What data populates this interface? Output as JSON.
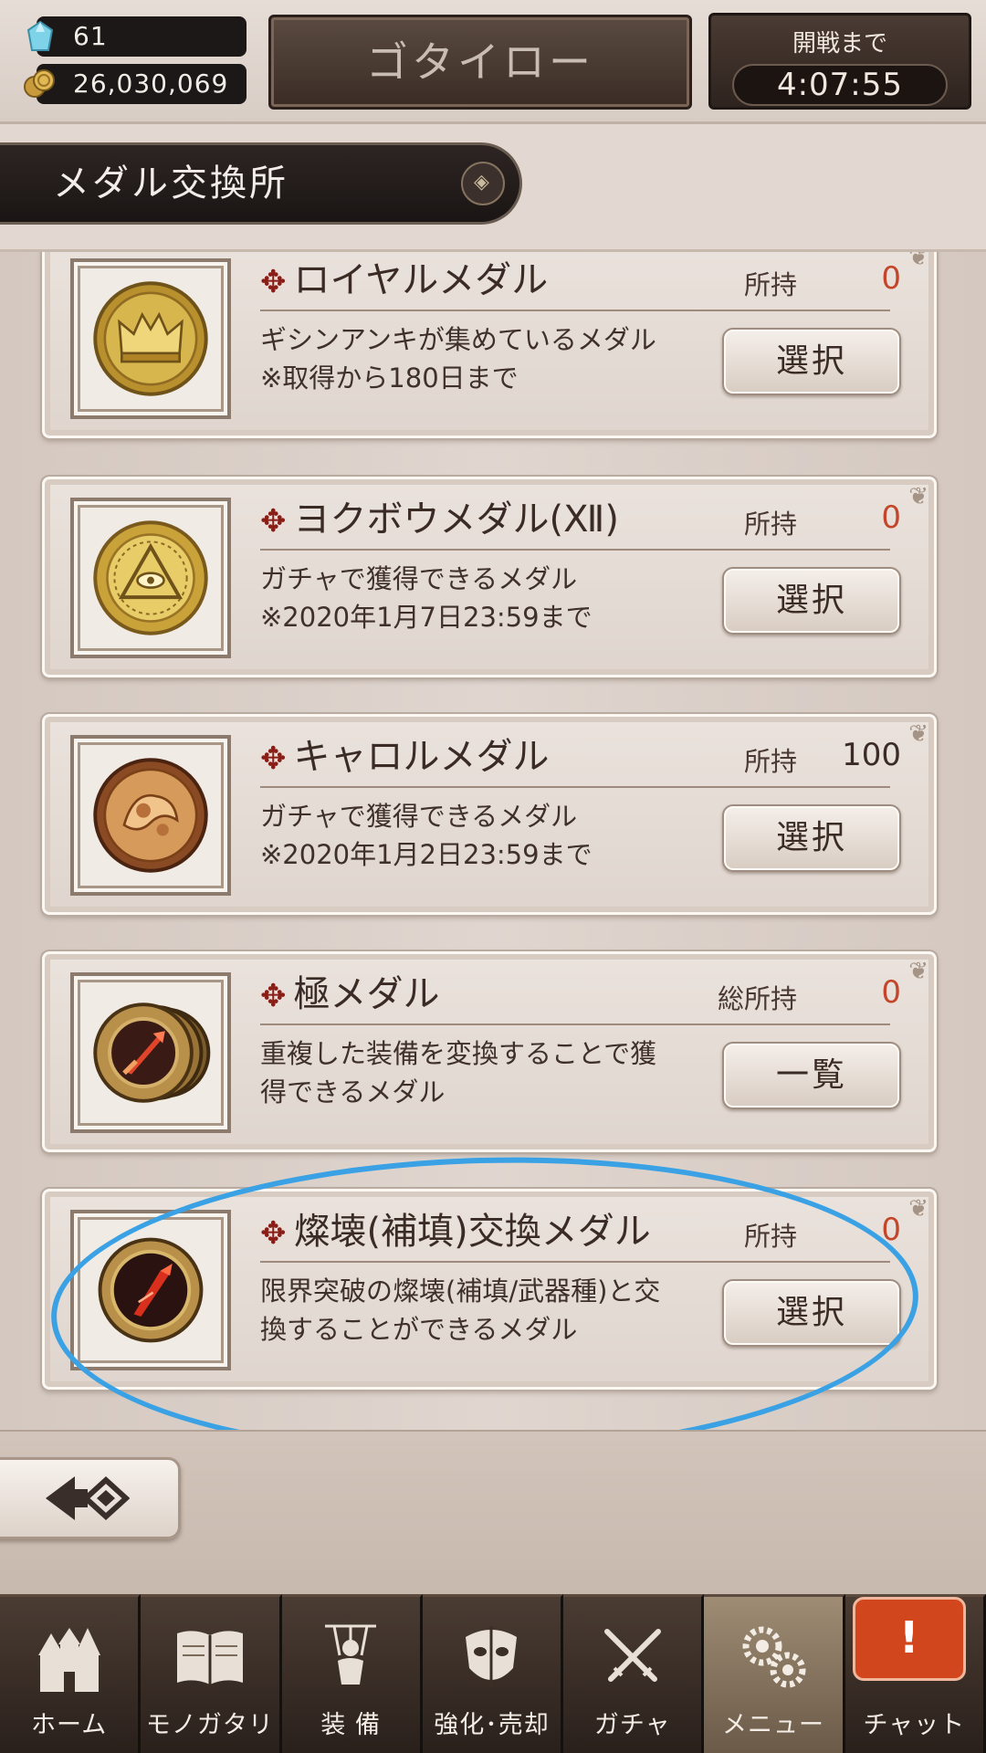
{
  "hud": {
    "gems": "61",
    "gold": "26,030,069",
    "player_name": "ゴタイロー",
    "timer_label": "開戦まで",
    "timer_value": "4:07:55"
  },
  "section": {
    "title": "メダル交換所"
  },
  "medals": [
    {
      "name": "ロイヤルメダル",
      "own_label": "所持",
      "count": "0",
      "desc": [
        "ギシンアンキが集めているメダル",
        "※取得から180日まで"
      ],
      "button": "選択",
      "icon": "crown-medal-icon"
    },
    {
      "name": "ヨクボウメダル(Ⅻ)",
      "own_label": "所持",
      "count": "0",
      "desc": [
        "ガチャで獲得できるメダル",
        "※2020年1月7日23:59まで"
      ],
      "button": "選択",
      "icon": "eye-medal-icon"
    },
    {
      "name": "キャロルメダル",
      "own_label": "所持",
      "count": "100",
      "desc": [
        "ガチャで獲得できるメダル",
        "※2020年1月2日23:59まで"
      ],
      "button": "選択",
      "icon": "carol-medal-icon"
    },
    {
      "name": "極メダル",
      "own_label": "総所持",
      "count": "0",
      "desc": [
        "重複した装備を変換することで獲",
        "得できるメダル"
      ],
      "button": "一覧",
      "icon": "sword-medal-stack-icon"
    },
    {
      "name": "燦壊(補填)交換メダル",
      "own_label": "所持",
      "count": "0",
      "desc": [
        "限界突破の燦壊(補填/武器種)と交",
        "換することができるメダル"
      ],
      "button": "選択",
      "icon": "red-blade-medal-icon"
    }
  ],
  "nav": {
    "items": [
      {
        "label": "ホーム",
        "icon": "castle-icon"
      },
      {
        "label": "モノガタリ",
        "icon": "book-icon"
      },
      {
        "label": "装 備",
        "icon": "puppet-icon"
      },
      {
        "label": "強化･売却",
        "icon": "mask-icon"
      },
      {
        "label": "ガチャ",
        "icon": "swords-icon"
      },
      {
        "label": "メニュー",
        "icon": "gears-icon"
      },
      {
        "label": "チャット",
        "icon": "chat-alert-icon"
      }
    ],
    "chat_alert": "!",
    "active_index": 5
  },
  "colors": {
    "count_red": "#c4462a",
    "highlight_blue": "#3aa2e4",
    "nav_active": "#9e8c74"
  }
}
